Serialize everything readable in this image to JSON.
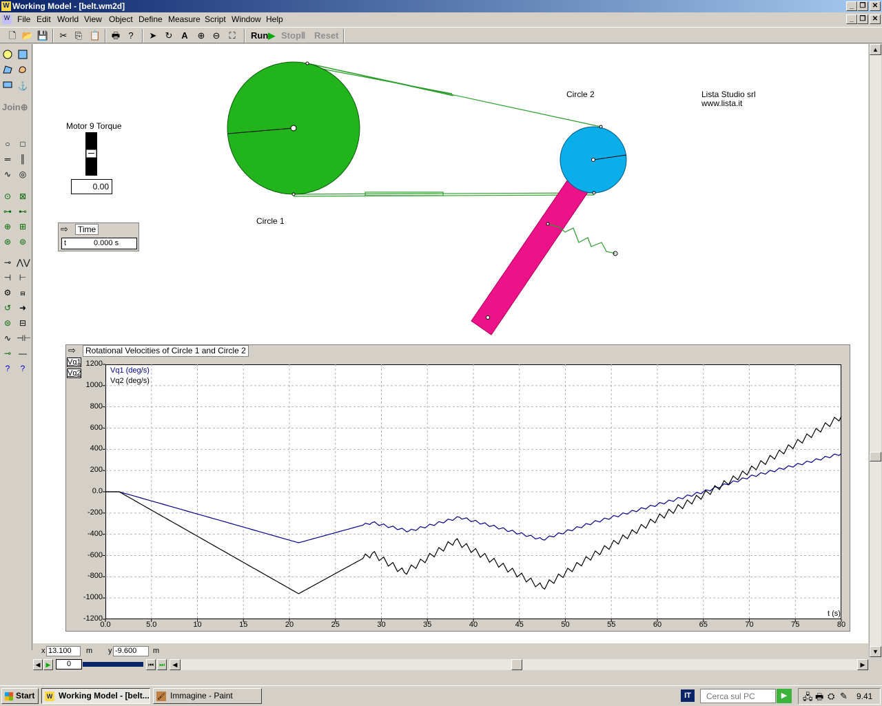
{
  "window": {
    "title": "Working Model - [belt.wm2d]"
  },
  "menu": [
    "File",
    "Edit",
    "World",
    "View",
    "Object",
    "Define",
    "Measure",
    "Script",
    "Window",
    "Help"
  ],
  "toolbar": {
    "run_label": "Run",
    "stop_label": "Stop",
    "reset_label": "Reset"
  },
  "palette": {
    "join_label": "Join"
  },
  "canvas": {
    "circle1_label": "Circle 1",
    "circle2_label": "Circle 2",
    "company_name": "Lista Studio srl",
    "company_web": "www.lista.it",
    "motor_label": "Motor 9 Torque",
    "motor_value": "0.00",
    "time_title": "Time",
    "time_var": "t",
    "time_value": "0.000 s"
  },
  "graph": {
    "title": "Rotational Velocities of Circle 1 and Circle 2",
    "button_vq1": "Vq1",
    "button_vq2": "Vq2"
  },
  "chart_data": {
    "type": "line",
    "title": "Rotational Velocities of Circle 1 and Circle 2",
    "xlabel": "t (s)",
    "ylabel": "",
    "xlim": [
      0,
      80
    ],
    "ylim": [
      -1200,
      1200
    ],
    "grid": true,
    "legend": "top-left",
    "x_ticks": [
      "0.0",
      "5.0",
      "10",
      "15",
      "20",
      "25",
      "30",
      "35",
      "40",
      "45",
      "50",
      "55",
      "60",
      "65",
      "70",
      "75",
      "80"
    ],
    "y_ticks": [
      "1200",
      "1000",
      "800",
      "600",
      "400",
      "200",
      "0.0",
      "-200",
      "-400",
      "-600",
      "-800",
      "-1000",
      "-1200"
    ],
    "series": [
      {
        "name": "Vq1 (deg/s)",
        "color": "#00008b",
        "x": [
          0,
          1.5,
          21,
          29,
          33,
          38.5,
          47.5,
          53,
          60,
          65,
          70,
          75,
          80
        ],
        "y": [
          0,
          0,
          -480,
          -290,
          -370,
          -240,
          -450,
          -290,
          -120,
          0,
          140,
          250,
          360
        ]
      },
      {
        "name": "Vq2 (deg/s)",
        "color": "#000000",
        "x": [
          0,
          1.5,
          21,
          29,
          32.5,
          38,
          47.5,
          53,
          60,
          65,
          70,
          75,
          80
        ],
        "y": [
          0,
          0,
          -960,
          -580,
          -760,
          -460,
          -900,
          -600,
          -250,
          -30,
          200,
          450,
          710
        ]
      }
    ]
  },
  "coords": {
    "x_label": "x",
    "x_value": "13.100",
    "x_unit": "m",
    "y_label": "y",
    "y_value": "-9.600",
    "y_unit": "m"
  },
  "tape": {
    "frame": "0"
  },
  "taskbar": {
    "start": "Start",
    "task1": "Working Model - [belt...",
    "task2": "Immagine - Paint",
    "lang": "IT",
    "search_placeholder": "Cerca sul PC",
    "clock": "9.41"
  }
}
